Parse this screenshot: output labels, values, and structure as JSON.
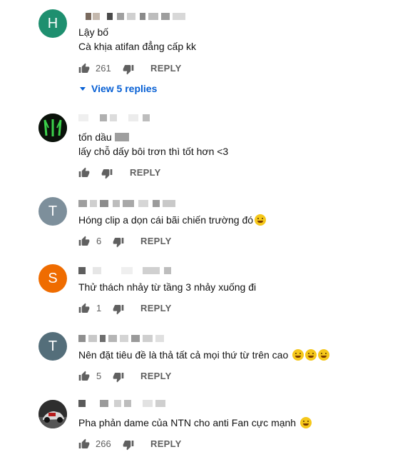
{
  "comments": [
    {
      "avatar_letter": "H",
      "avatar_color": "#1e8f6f",
      "lines": [
        "Lậy bố",
        "Cà khịa atifan đẳng cấp kk"
      ],
      "likes": "261",
      "reply_label": "REPLY",
      "view_replies": "View 5 replies"
    },
    {
      "avatar_letter": "",
      "avatar_type": "image",
      "lines": [
        "tốn dầu",
        "lấy chỗ dấy bôi trơn thì tốt hơn <3"
      ],
      "likes": "",
      "reply_label": "REPLY"
    },
    {
      "avatar_letter": "T",
      "avatar_color": "#7d8f9b",
      "lines": [
        "Hóng clip a dọn cái bãi chiến trường đó"
      ],
      "likes": "6",
      "reply_label": "REPLY"
    },
    {
      "avatar_letter": "S",
      "avatar_color": "#ef6c00",
      "lines": [
        "Thử thách nhảy từ tầng 3 nhảy xuống đi"
      ],
      "likes": "1",
      "reply_label": "REPLY"
    },
    {
      "avatar_letter": "T",
      "avatar_color": "#546e7a",
      "lines": [
        "Nên đặt tiêu đề là thả tất cả mọi thứ từ trên cao"
      ],
      "likes": "5",
      "reply_label": "REPLY"
    },
    {
      "avatar_letter": "",
      "avatar_type": "image",
      "lines": [
        "Pha phản dame của NTN cho anti Fan cực mạnh"
      ],
      "likes": "266",
      "reply_label": "REPLY"
    }
  ]
}
